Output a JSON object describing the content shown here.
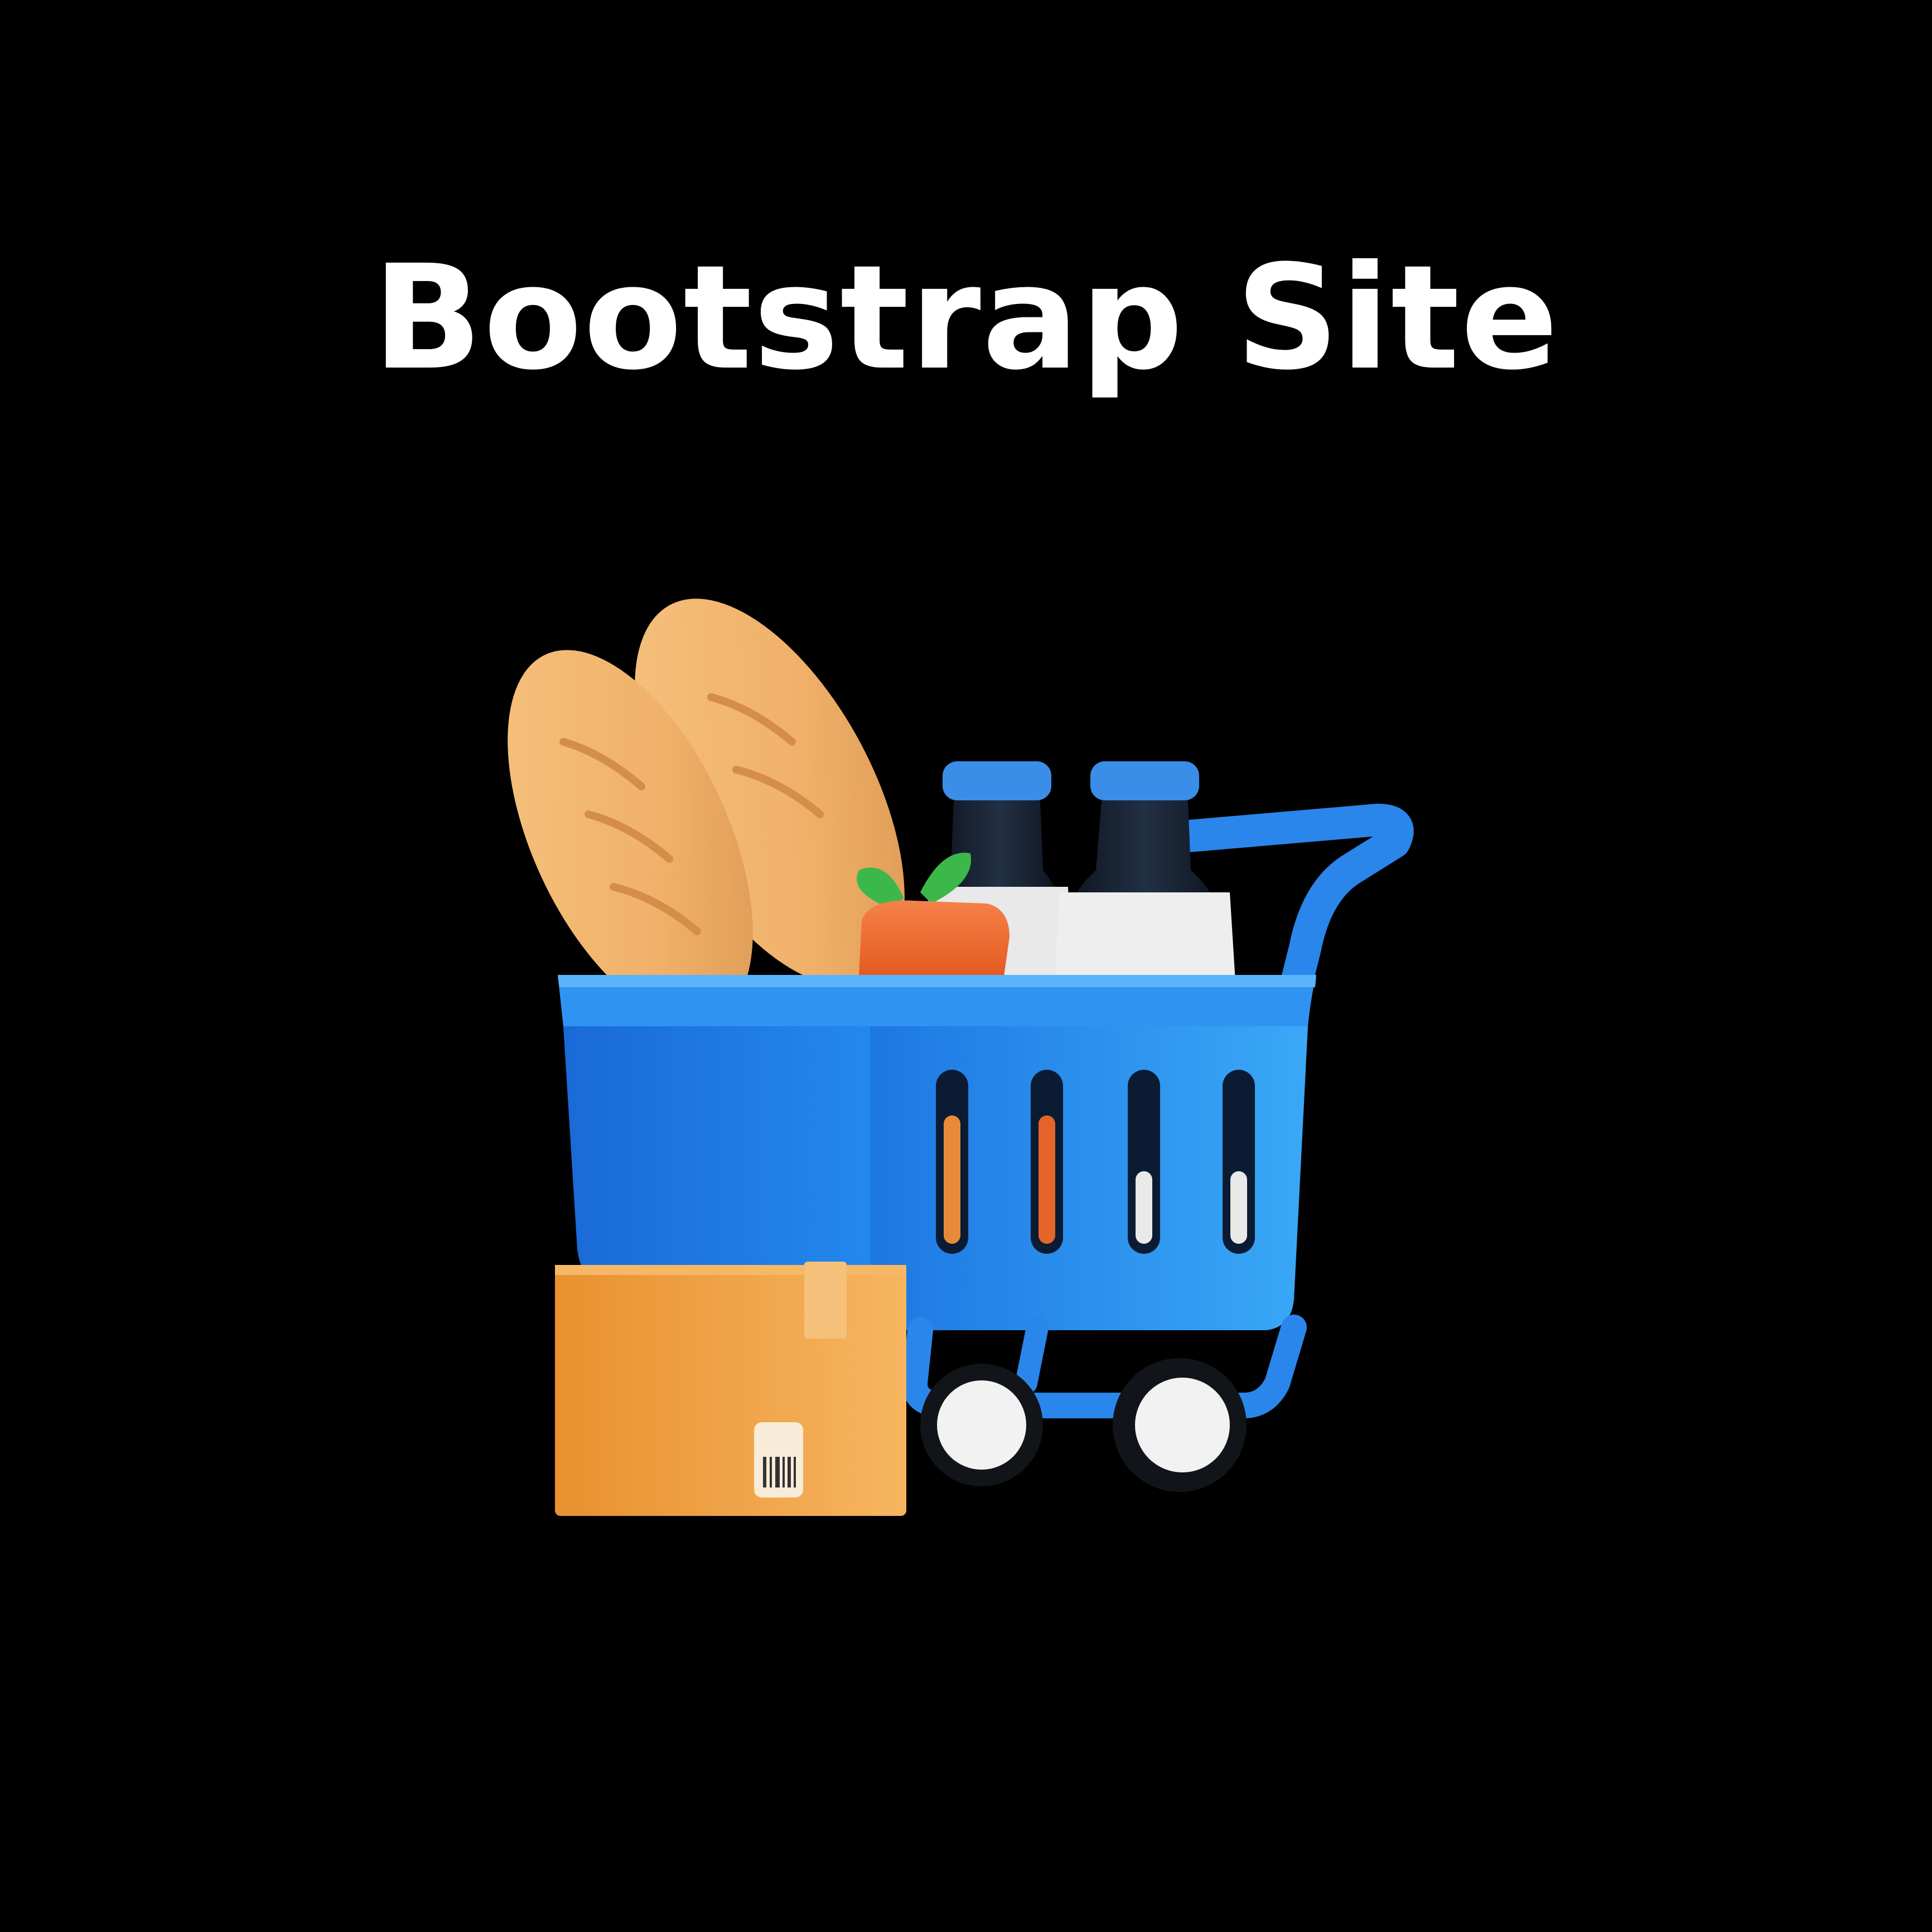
{
  "title": "Bootstrap Site",
  "illustration": {
    "icon": "shopping-cart-icon",
    "contents": [
      "bread-icon",
      "milk-bottle-icon",
      "carrot-icon",
      "box-icon"
    ]
  },
  "colors": {
    "background": "#000000",
    "title": "#ffffff",
    "cart_blue": "#2f8ff0",
    "cart_blue_dark": "#1a6fd6",
    "bread": "#f0b76c",
    "box": "#f2a24a",
    "carrot": "#f06d2e",
    "leaf": "#3cb84a",
    "bottle_cap": "#3a8ee8"
  }
}
